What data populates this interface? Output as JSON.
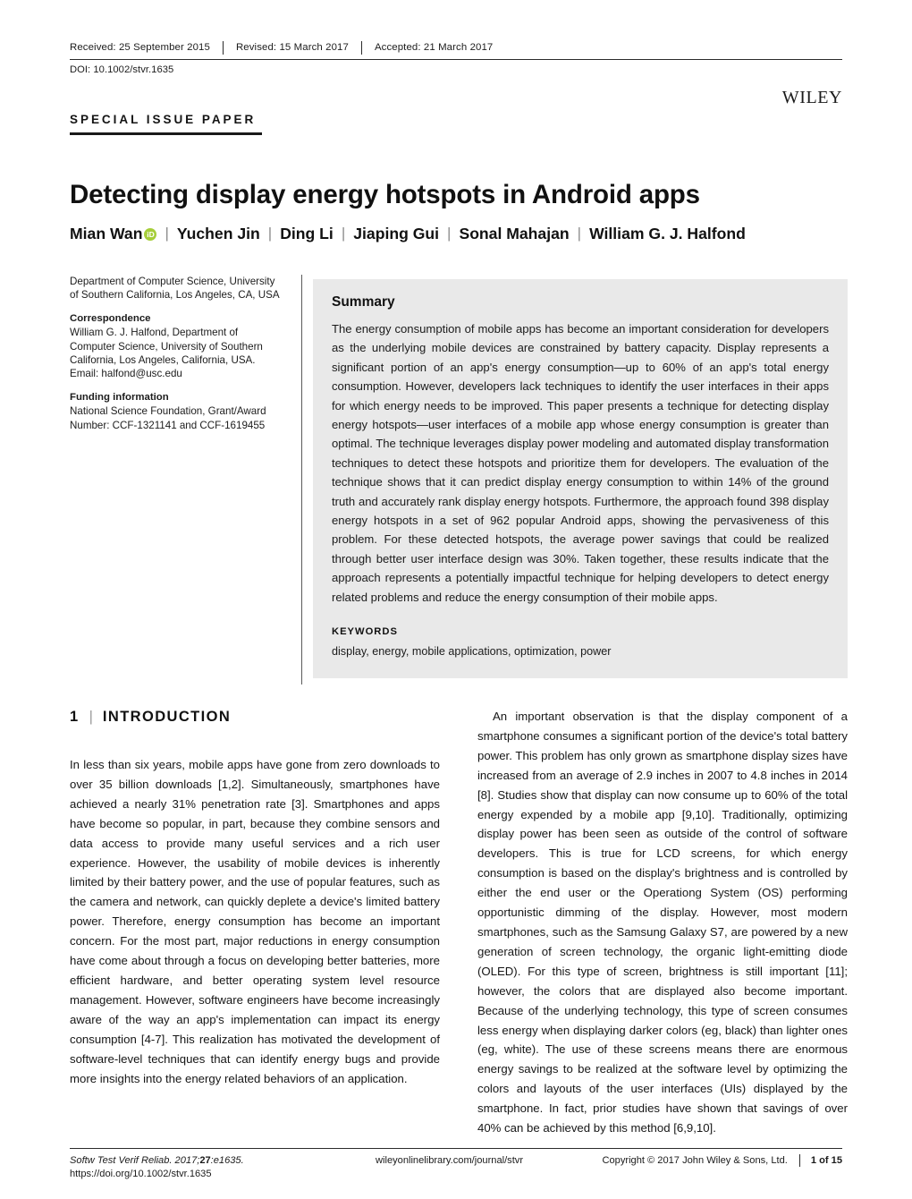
{
  "article_history": {
    "received": "Received: 25 September 2015",
    "revised": "Revised: 15 March 2017",
    "accepted": "Accepted: 21 March 2017"
  },
  "doi_line": "DOI: 10.1002/stvr.1635",
  "publisher": {
    "logo_text": "Wiley"
  },
  "issue_type": "SPECIAL ISSUE PAPER",
  "title": "Detecting display energy hotspots in Android apps",
  "authors": [
    {
      "name": "Mian Wan",
      "orcid": "iD"
    },
    {
      "name": "Yuchen Jin"
    },
    {
      "name": "Ding Li"
    },
    {
      "name": "Jiaping Gui"
    },
    {
      "name": "Sonal Mahajan"
    },
    {
      "name": "William G. J. Halfond"
    }
  ],
  "author_separator": "|",
  "meta": {
    "affiliation": "Department of Computer Science, University of Southern California, Los Angeles, CA, USA",
    "correspondence_label": "Correspondence",
    "correspondence": "William G. J. Halfond, Department of Computer Science, University of Southern California, Los Angeles, California, USA. Email: halfond@usc.edu",
    "funding_label": "Funding information",
    "funding": "National Science Foundation, Grant/Award Number: CCF-1321141 and CCF-1619455"
  },
  "summary": {
    "heading": "Summary",
    "text": "The energy consumption of mobile apps has become an important consideration for developers as the underlying mobile devices are constrained by battery capacity. Display represents a significant portion of an app's energy consumption—up to 60% of an app's total energy consumption. However, developers lack techniques to identify the user interfaces in their apps for which energy needs to be improved. This paper presents a technique for detecting display energy hotspots—user interfaces of a mobile app whose energy consumption is greater than optimal. The technique leverages display power modeling and automated display transformation techniques to detect these hotspots and prioritize them for developers. The evaluation of the technique shows that it can predict display energy consumption to within 14% of the ground truth and accurately rank display energy hotspots. Furthermore, the approach found 398 display energy hotspots in a set of 962 popular Android apps, showing the pervasiveness of this problem. For these detected hotspots, the average power savings that could be realized through better user interface design was 30%. Taken together, these results indicate that the approach represents a potentially impactful technique for helping developers to detect energy related problems and reduce the energy consumption of their mobile apps.",
    "keywords_heading": "KEYWORDS",
    "keywords": "display, energy, mobile applications, optimization, power"
  },
  "section": {
    "number": "1",
    "divider": "|",
    "heading": "INTRODUCTION"
  },
  "body": {
    "left_paragraph": "In less than six years, mobile apps have gone from zero downloads to over 35 billion downloads [1,2]. Simultaneously, smartphones have achieved a nearly 31% penetration rate [3]. Smartphones and apps have become so popular, in part, because they combine sensors and data access to provide many useful services and a rich user experience. However, the usability of mobile devices is inherently limited by their battery power, and the use of popular features, such as the camera and network, can quickly deplete a device's limited battery power. Therefore, energy consumption has become an important concern. For the most part, major reductions in energy consumption have come about through a focus on developing better batteries, more efficient hardware, and better operating system level resource management. However, software engineers have become increasingly aware of the way an app's implementation can impact its energy consumption [4-7]. This realization has motivated the development of software-level techniques that can identify energy bugs and provide more insights into the energy related behaviors of an application.",
    "right_paragraph": "An important observation is that the display component of a smartphone consumes a significant portion of the device's total battery power. This problem has only grown as smartphone display sizes have increased from an average of 2.9 inches in 2007 to 4.8 inches in 2014 [8]. Studies show that display can now consume up to 60% of the total energy expended by a mobile app [9,10]. Traditionally, optimizing display power has been seen as outside of the control of software developers. This is true for LCD screens, for which energy consumption is based on the display's brightness and is controlled by either the end user or the Operationg System (OS) performing opportunistic dimming of the display. However, most modern smartphones, such as the Samsung Galaxy S7, are powered by a new generation of screen technology, the organic light-emitting diode (OLED). For this type of screen, brightness is still important [11]; however, the colors that are displayed also become important. Because of the underlying technology, this type of screen consumes less energy when displaying darker colors (eg, black) than lighter ones (eg, white). The use of these screens means there are enormous energy savings to be realized at the software level by optimizing the colors and layouts of the user interfaces (UIs) displayed by the smartphone. In fact, prior studies have shown that savings of over 40% can be achieved by this method [6,9,10]."
  },
  "footer": {
    "journal_citation": "Softw Test Verif Reliab. 2017;",
    "journal_volume": "27",
    "journal_citation_tail": ":e1635.",
    "doi_url": "https://doi.org/10.1002/stvr.1635",
    "library_url": "wileyonlinelibrary.com/journal/stvr",
    "copyright": "Copyright © 2017 John Wiley & Sons, Ltd.",
    "page_number": "1 of 15"
  },
  "colors": {
    "summary_background": "#e9e9e9",
    "orcid_green": "#a6ce39",
    "rule": "#2b2b2b",
    "text": "#1a1a1a"
  }
}
